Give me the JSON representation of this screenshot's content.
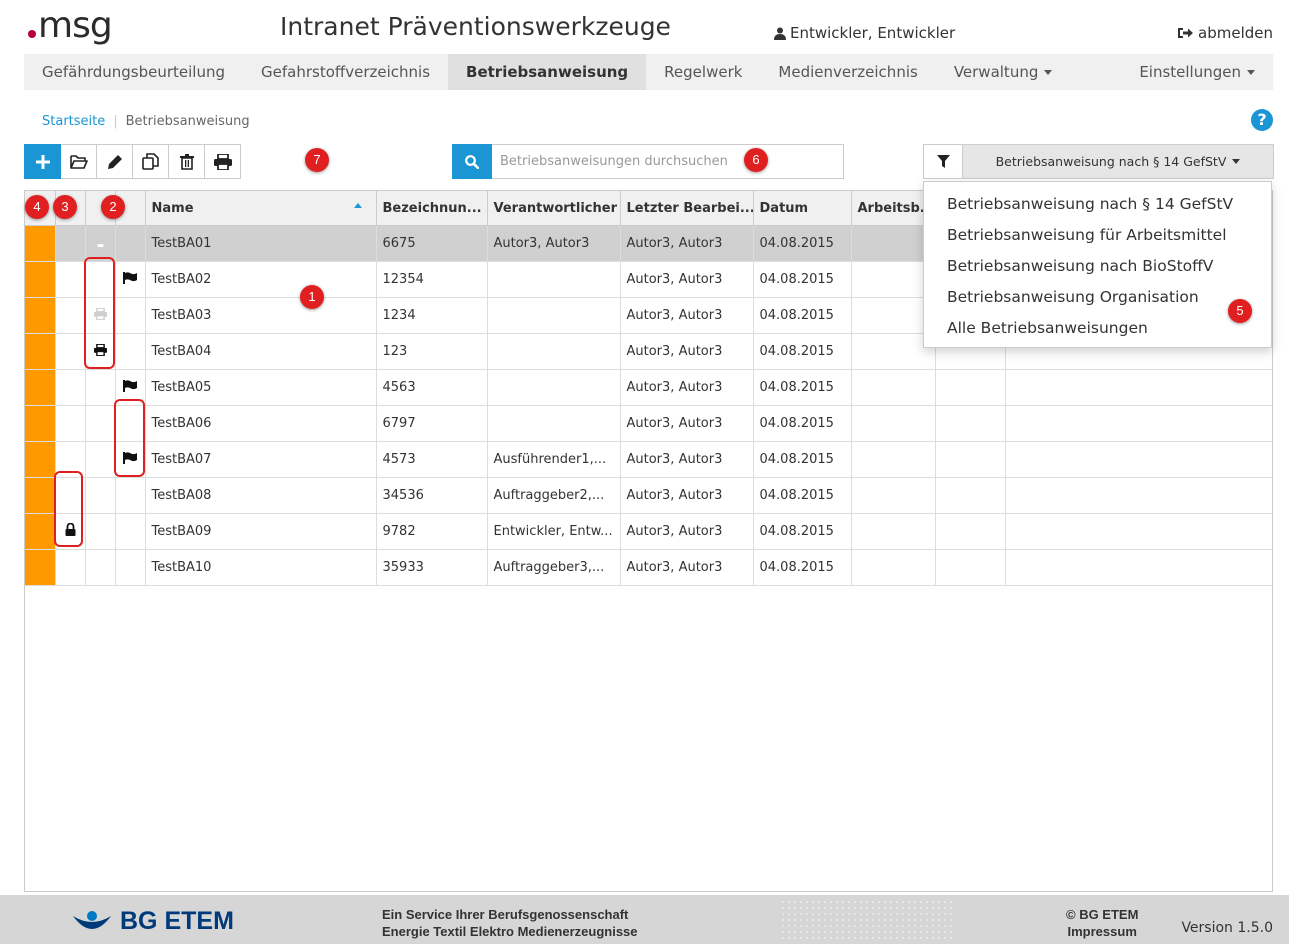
{
  "header": {
    "logo_text": "msg",
    "title": "Intranet Präventionswerkzeuge",
    "user": "Entwickler, Entwickler",
    "logout": "abmelden"
  },
  "nav": {
    "items": [
      {
        "label": "Gefährdungsbeurteilung"
      },
      {
        "label": "Gefahrstoffverzeichnis"
      },
      {
        "label": "Betriebsanweisung"
      },
      {
        "label": "Regelwerk"
      },
      {
        "label": "Medienverzeichnis"
      },
      {
        "label": "Verwaltung"
      },
      {
        "label": "Einstellungen"
      }
    ],
    "active": "Betriebsanweisung"
  },
  "breadcrumb": {
    "home": "Startseite",
    "separator": "|",
    "current": "Betriebsanweisung"
  },
  "help_label": "?",
  "toolbar": {
    "icons": [
      "plus-icon",
      "folder-open-icon",
      "pencil-icon",
      "copy-icon",
      "trash-icon",
      "print-icon"
    ]
  },
  "search": {
    "placeholder": "Betriebsanweisungen durchsuchen",
    "value": ""
  },
  "filter": {
    "selected": "Betriebsanweisung nach § 14 GefStV"
  },
  "dropdown": {
    "options": [
      "Betriebsanweisung nach § 14 GefStV",
      "Betriebsanweisung für Arbeitsmittel",
      "Betriebsanweisung nach BioStoffV",
      "Betriebsanweisung Organisation",
      "Alle Betriebsanweisungen"
    ]
  },
  "table": {
    "columns": [
      "",
      "",
      "",
      "",
      "Name",
      "Bezeichnun...",
      "Verantwortlicher",
      "Letzter Bearbei...",
      "Datum",
      "Arbeitsb...",
      "",
      ""
    ],
    "rows": [
      {
        "lock": false,
        "print": "faded",
        "flag": false,
        "name": "TestBA01",
        "bez": "6675",
        "verant": "Autor3, Autor3",
        "letzter": "Autor3, Autor3",
        "datum": "04.08.2015",
        "selected": true
      },
      {
        "lock": false,
        "print": "none",
        "flag": true,
        "name": "TestBA02",
        "bez": "12354",
        "verant": "",
        "letzter": "Autor3, Autor3",
        "datum": "04.08.2015",
        "selected": false
      },
      {
        "lock": false,
        "print": "faded",
        "flag": false,
        "name": "TestBA03",
        "bez": "1234",
        "verant": "",
        "letzter": "Autor3, Autor3",
        "datum": "04.08.2015",
        "selected": false
      },
      {
        "lock": false,
        "print": "solid",
        "flag": false,
        "name": "TestBA04",
        "bez": "123",
        "verant": "",
        "letzter": "Autor3, Autor3",
        "datum": "04.08.2015",
        "selected": false
      },
      {
        "lock": false,
        "print": "none",
        "flag": true,
        "name": "TestBA05",
        "bez": "4563",
        "verant": "",
        "letzter": "Autor3, Autor3",
        "datum": "04.08.2015",
        "selected": false
      },
      {
        "lock": false,
        "print": "none",
        "flag": false,
        "name": "TestBA06",
        "bez": "6797",
        "verant": "",
        "letzter": "Autor3, Autor3",
        "datum": "04.08.2015",
        "selected": false
      },
      {
        "lock": false,
        "print": "none",
        "flag": true,
        "name": "TestBA07",
        "bez": "4573",
        "verant": "Ausführender1,...",
        "letzter": "Autor3, Autor3",
        "datum": "04.08.2015",
        "selected": false
      },
      {
        "lock": false,
        "print": "none",
        "flag": false,
        "name": "TestBA08",
        "bez": "34536",
        "verant": "Auftraggeber2,...",
        "letzter": "Autor3, Autor3",
        "datum": "04.08.2015",
        "selected": false
      },
      {
        "lock": true,
        "print": "none",
        "flag": false,
        "name": "TestBA09",
        "bez": "9782",
        "verant": "Entwickler, Entw...",
        "letzter": "Autor3, Autor3",
        "datum": "04.08.2015",
        "selected": false
      },
      {
        "lock": false,
        "print": "none",
        "flag": false,
        "name": "TestBA10",
        "bez": "35933",
        "verant": "Auftraggeber3,...",
        "letzter": "Autor3, Autor3",
        "datum": "04.08.2015",
        "selected": false
      }
    ]
  },
  "annotations": [
    "1",
    "2",
    "3",
    "4",
    "5",
    "6",
    "7"
  ],
  "footer": {
    "logo_text": "BG ETEM",
    "service_line1": "Ein Service Ihrer Berufsgenossenschaft",
    "service_line2": "Energie Textil Elektro Medienerzeugnisse",
    "copyright": "© BG ETEM",
    "impressum": "Impressum",
    "version": "Version 1.5.0"
  },
  "colors": {
    "accent": "#1a96d4",
    "status": "#ff9900",
    "annotation": "#e02020"
  }
}
